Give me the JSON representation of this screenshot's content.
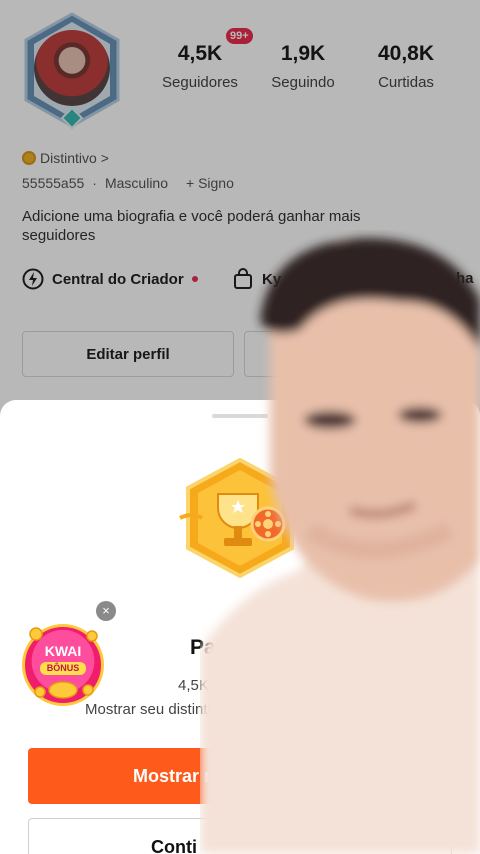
{
  "profile": {
    "stats": [
      {
        "value": "4,5K",
        "label": "Seguidores"
      },
      {
        "value": "1,9K",
        "label": "Seguindo"
      },
      {
        "value": "40,8K",
        "label": "Curtidas"
      }
    ],
    "notification_badge": "99+",
    "distintivo_label": "Distintivo",
    "distintivo_chevron": ">",
    "user_id": "55555a55",
    "separator": "·",
    "gender": "Masculino",
    "sign_label": "+ Signo",
    "bio": "Adicione uma biografia e você poderá ganhar mais seguidores",
    "creator_center_label": "Central do Criador",
    "shop_label": "Ky",
    "cut_text": "ha",
    "edit_profile_label": "Editar perfil"
  },
  "sheet": {
    "title": "Parabén",
    "subtitle1": "4,5K Segu",
    "subtitle2": "Mostrar seu distintiv",
    "primary_button": "Mostrar m",
    "secondary_button": "Conti"
  },
  "kwai_bonus": {
    "title_line1": "KWAI",
    "title_line2": "BÔNUS",
    "close": "×"
  },
  "colors": {
    "accent": "#fe5a1c",
    "badge_red": "#ee2d4f",
    "gold": "#f0b428"
  }
}
